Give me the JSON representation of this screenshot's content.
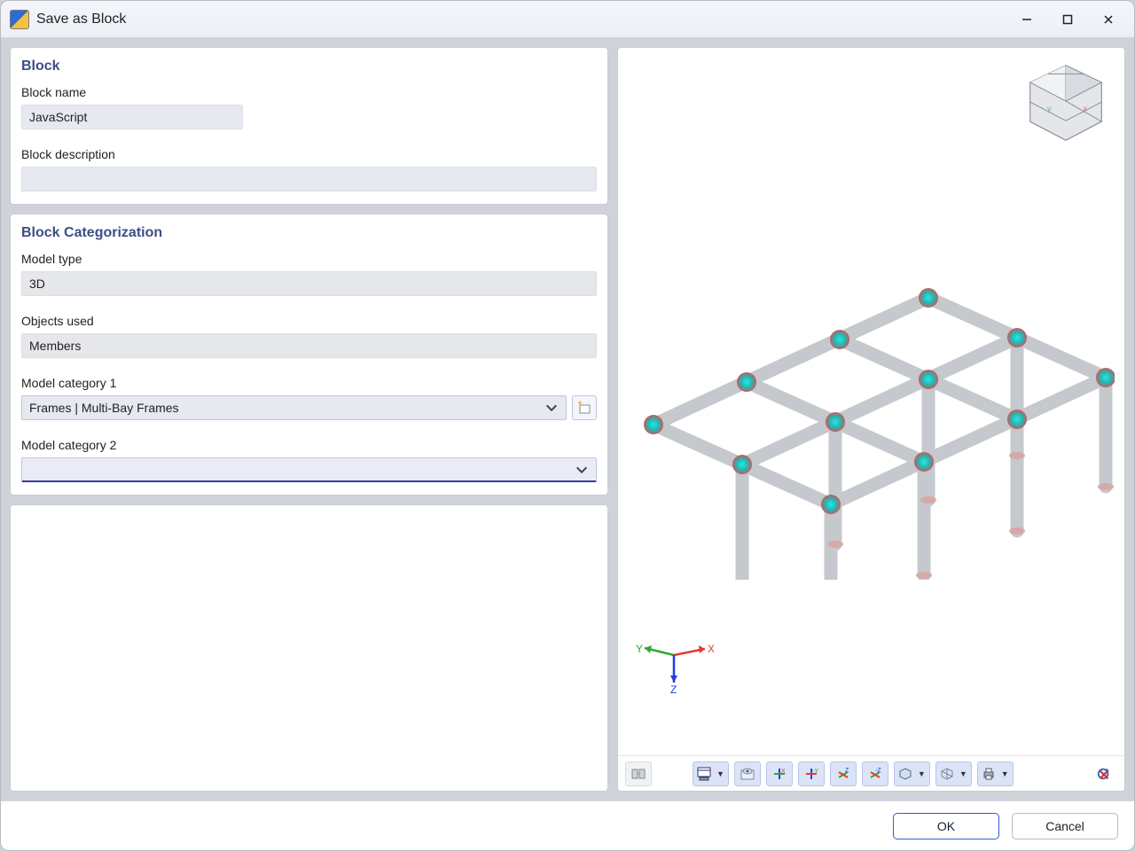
{
  "window": {
    "title": "Save as Block"
  },
  "sections": {
    "block_title": "Block",
    "categorization_title": "Block Categorization"
  },
  "labels": {
    "block_name": "Block name",
    "block_description": "Block description",
    "model_type": "Model type",
    "objects_used": "Objects used",
    "model_cat_1": "Model category 1",
    "model_cat_2": "Model category 2"
  },
  "values": {
    "block_name": "JavaScript",
    "block_description": "",
    "model_type": "3D",
    "objects_used": "Members",
    "model_cat_1": "Frames | Multi-Bay Frames",
    "model_cat_2": ""
  },
  "axis": {
    "x": "X",
    "y": "Y",
    "z": "Z"
  },
  "footer": {
    "ok": "OK",
    "cancel": "Cancel"
  }
}
